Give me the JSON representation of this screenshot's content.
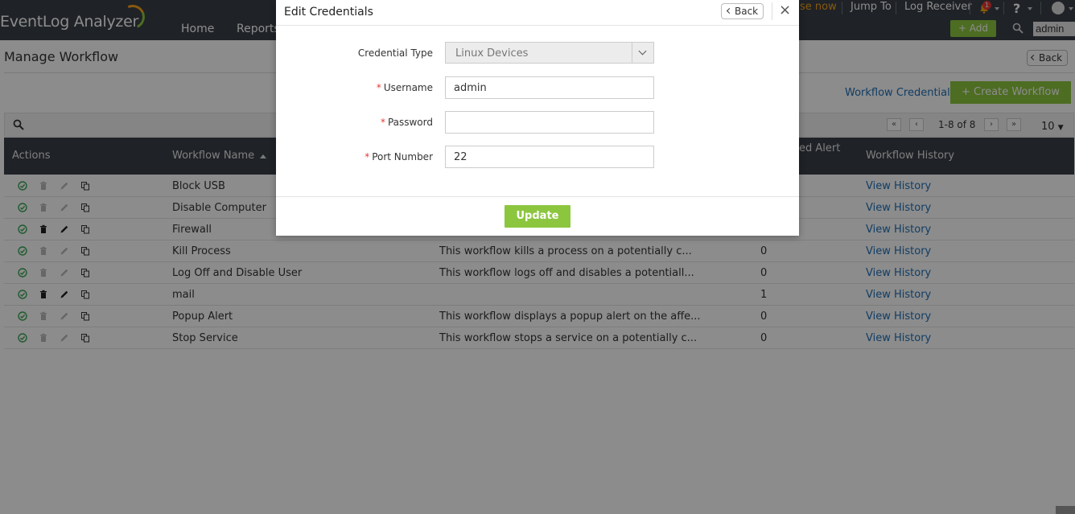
{
  "app": {
    "logo": "EventLog Analyzer"
  },
  "topnav": [
    "Home",
    "Reports"
  ],
  "toplinks": {
    "license": "ase now",
    "jump_to": "Jump To",
    "log_receiver": "Log Receiver",
    "notif_count": "1",
    "help": "?"
  },
  "header_actions": {
    "add_label": "+ Add",
    "search_value": "admin"
  },
  "page": {
    "title": "Manage Workflow",
    "back_label": "Back",
    "workflow_credentials_label": "Workflow Credentials",
    "create_workflow_label": "+ Create Workflow",
    "pager": {
      "range": "1-8 of 8",
      "per_page": "10"
    }
  },
  "table": {
    "headers": {
      "actions": "Actions",
      "workflow_name": "Workflow Name",
      "alert": "ed Alert",
      "history": "Workflow History"
    },
    "rows": [
      {
        "name": "Block USB",
        "desc": "",
        "count": "",
        "history": "View History",
        "editable": false
      },
      {
        "name": "Disable Computer",
        "desc": "",
        "count": "",
        "history": "View History",
        "editable": false
      },
      {
        "name": "Firewall",
        "desc": "",
        "count": "",
        "history": "View History",
        "editable": true
      },
      {
        "name": "Kill Process",
        "desc": "This workflow kills a process on a potentially c...",
        "count": "0",
        "history": "View History",
        "editable": false
      },
      {
        "name": "Log Off and Disable User",
        "desc": "This workflow logs off and disables a potentiall...",
        "count": "0",
        "history": "View History",
        "editable": false
      },
      {
        "name": "mail",
        "desc": "",
        "count": "1",
        "history": "View History",
        "editable": true
      },
      {
        "name": "Popup Alert",
        "desc": "This workflow displays a popup alert on the affe...",
        "count": "0",
        "history": "View History",
        "editable": false
      },
      {
        "name": "Stop Service",
        "desc": "This workflow stops a service on a potentially c...",
        "count": "0",
        "history": "View History",
        "editable": false
      }
    ]
  },
  "modal": {
    "title": "Edit Credentials",
    "back_label": "Back",
    "close": "×",
    "fields": {
      "credential_type": {
        "label": "Credential Type",
        "value": "Linux Devices"
      },
      "username": {
        "label": "Username",
        "value": "admin"
      },
      "password": {
        "label": "Password",
        "value": ""
      },
      "port": {
        "label": "Port Number",
        "value": "22"
      }
    },
    "required_mark": "*",
    "update_label": "Update"
  },
  "colors": {
    "accent_green": "#8cc63f",
    "header_dark": "#3a3f48",
    "link_blue": "#1f6fb6"
  }
}
